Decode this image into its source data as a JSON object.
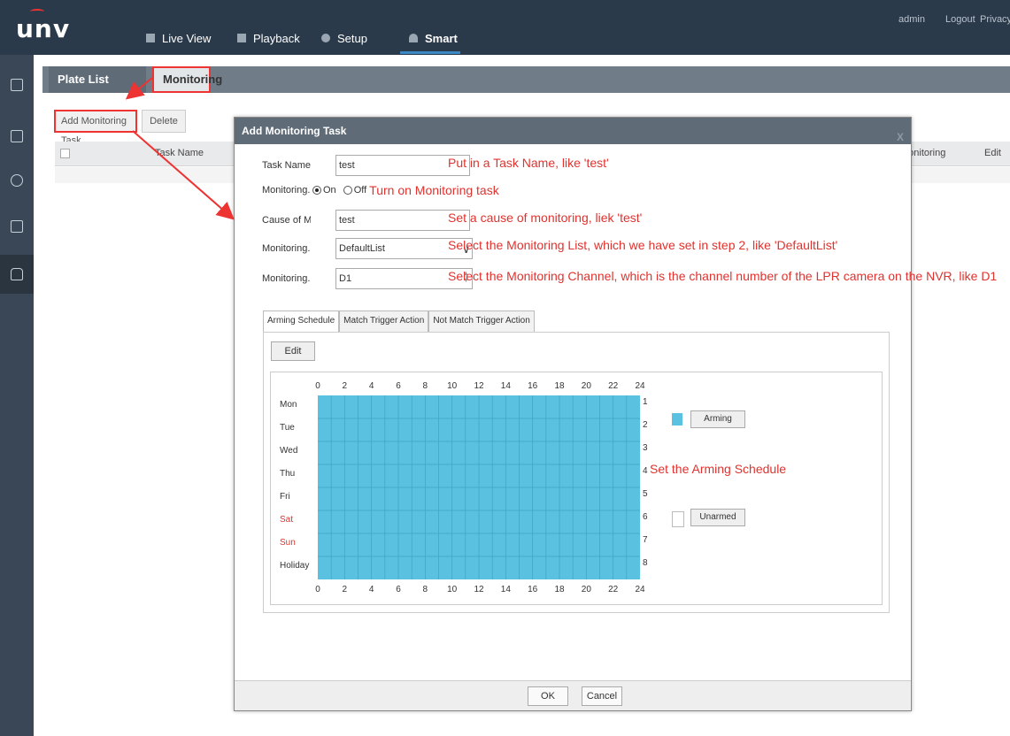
{
  "app": {
    "logo": "unv"
  },
  "nav": {
    "items": [
      {
        "label": "Live View",
        "icon": "monitor-icon"
      },
      {
        "label": "Playback",
        "icon": "film-icon"
      },
      {
        "label": "Setup",
        "icon": "gear-icon"
      },
      {
        "label": "Smart",
        "icon": "person-icon",
        "active": true
      }
    ],
    "user": "admin",
    "logout": "Logout",
    "privacy": "Privacy"
  },
  "sidebar": {
    "icons": [
      "camera-settings-icon",
      "calendar-icon",
      "radar-icon",
      "display-icon",
      "vehicle-icon"
    ],
    "active_index": 4
  },
  "tabs": {
    "plate_list": "Plate List",
    "monitoring": "Monitoring"
  },
  "toolbar": {
    "add": "Add Monitoring Task",
    "delete": "Delete"
  },
  "table": {
    "headers": {
      "task_name": "Task Name",
      "monitoring": "Monitoring",
      "edit": "Edit"
    }
  },
  "dialog": {
    "title": "Add Monitoring Task",
    "close": "X",
    "fields": {
      "task_name": {
        "label": "Task Name",
        "value": "test"
      },
      "monitoring": {
        "label": "Monitoring...",
        "on": "On",
        "off": "Off",
        "selected": "On"
      },
      "cause": {
        "label": "Cause of M...",
        "value": "test"
      },
      "list": {
        "label": "Monitoring...",
        "value": "DefaultList"
      },
      "channel": {
        "label": "Monitoring...",
        "value": "D1"
      }
    },
    "annotations": {
      "task_name": "Put in a Task Name, like 'test'",
      "monitoring": "Turn on Monitoring task",
      "cause": "Set a cause of monitoring, liek 'test'",
      "list": "Select the Monitoring List, which we have set in step 2, like 'DefaultList'",
      "channel": "Select the Monitoring Channel, which is the channel number of the LPR camera on the NVR, like D1",
      "schedule": "Set the Arming Schedule"
    },
    "subtabs": [
      "Arming Schedule",
      "Match Trigger Action",
      "Not Match Trigger Action"
    ],
    "schedule": {
      "edit": "Edit",
      "hours": [
        "0",
        "2",
        "4",
        "6",
        "8",
        "10",
        "12",
        "14",
        "16",
        "18",
        "20",
        "22",
        "24"
      ],
      "days": [
        "Mon",
        "Tue",
        "Wed",
        "Thu",
        "Fri",
        "Sat",
        "Sun",
        "Holiday"
      ],
      "row_numbers": [
        "1",
        "2",
        "3",
        "4",
        "5",
        "6",
        "7",
        "8"
      ],
      "arming_label": "Arming",
      "unarmed_label": "Unarmed",
      "arming_color": "#5bc1e0",
      "state": "all armed"
    },
    "ok": "OK",
    "cancel": "Cancel"
  },
  "colors": {
    "annotation": "#e0322e",
    "topbar": "#2b3a4a",
    "sidebar": "#3a4756"
  }
}
